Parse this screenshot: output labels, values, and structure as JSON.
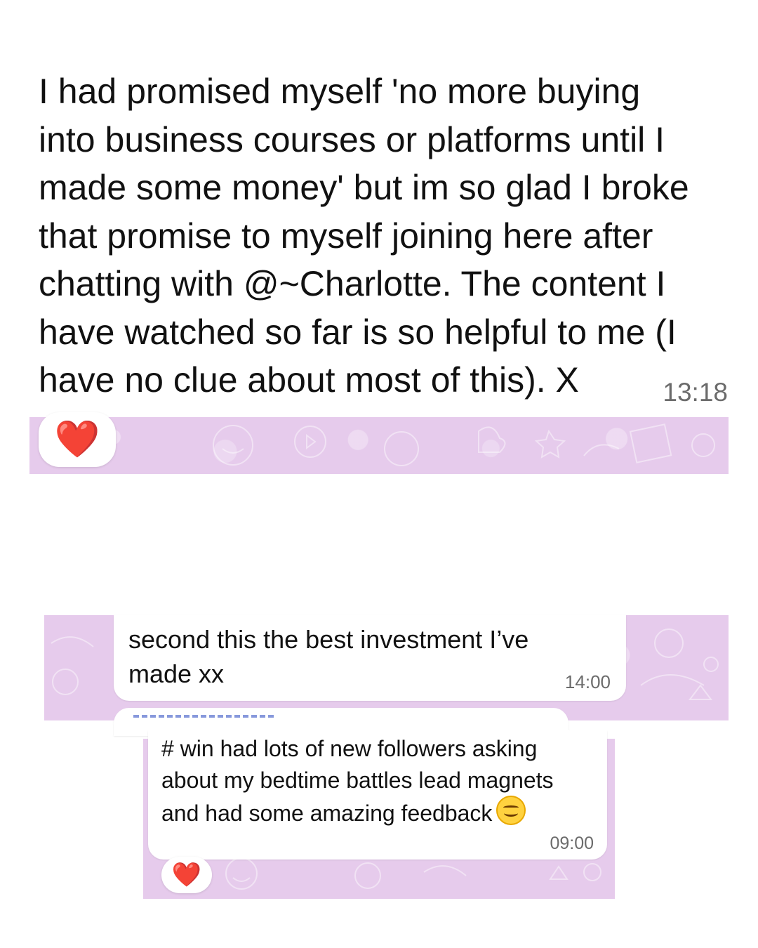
{
  "messages": [
    {
      "text": "I had promised myself 'no more buying\ninto business courses or platforms until I\nmade some money' but im so glad I broke\nthat promise to myself joining here after\nchatting with @~Charlotte. The content I\nhave watched so far is so helpful to me (I\nhave no clue about most of this). X",
      "time": "13:18",
      "reaction": "❤️"
    },
    {
      "text": "second this the best investment I’ve made xx",
      "time": "14:00"
    },
    {
      "text": "# win had lots of new followers asking about my bedtime battles lead magnets and had some amazing feedback",
      "emoji": "smiling-face-icon",
      "time": "09:00",
      "reaction": "❤️"
    }
  ],
  "colors": {
    "chat_background": "#e6cbec",
    "bubble": "#ffffff",
    "timestamp": "#6b6b6b",
    "heart": "#e8182b"
  }
}
